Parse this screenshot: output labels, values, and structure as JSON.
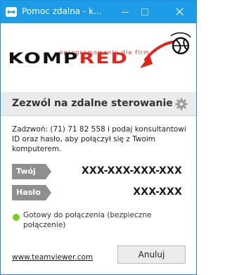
{
  "window": {
    "title": "Pomoc zdalna - k..."
  },
  "banner": {
    "tagline": "oprogramowanie dla firm",
    "brand_dark": "KOMP",
    "brand_red": "RED"
  },
  "panel": {
    "heading": "Zezwól na zdalne sterowanie",
    "instructions": "Zadzwoń: (71) 71 82 558 i podaj konsultantowi ID oraz hasło, aby połączył się z Twoim komputerem.",
    "id_label": "Twój ID",
    "id_value": "XXX-XXX-XXX-XXX",
    "password_label": "Hasło",
    "password_value": "XXX-XXX",
    "status": "Gotowy do połączenia (bezpieczne połączenie)"
  },
  "footer": {
    "link": "www.teamviewer.com",
    "cancel": "Anuluj"
  },
  "colors": {
    "titlebar": "#1c9be6",
    "brand_red": "#e3241b",
    "status_green": "#7ccf20",
    "tag_gray": "#8f8f8f"
  }
}
